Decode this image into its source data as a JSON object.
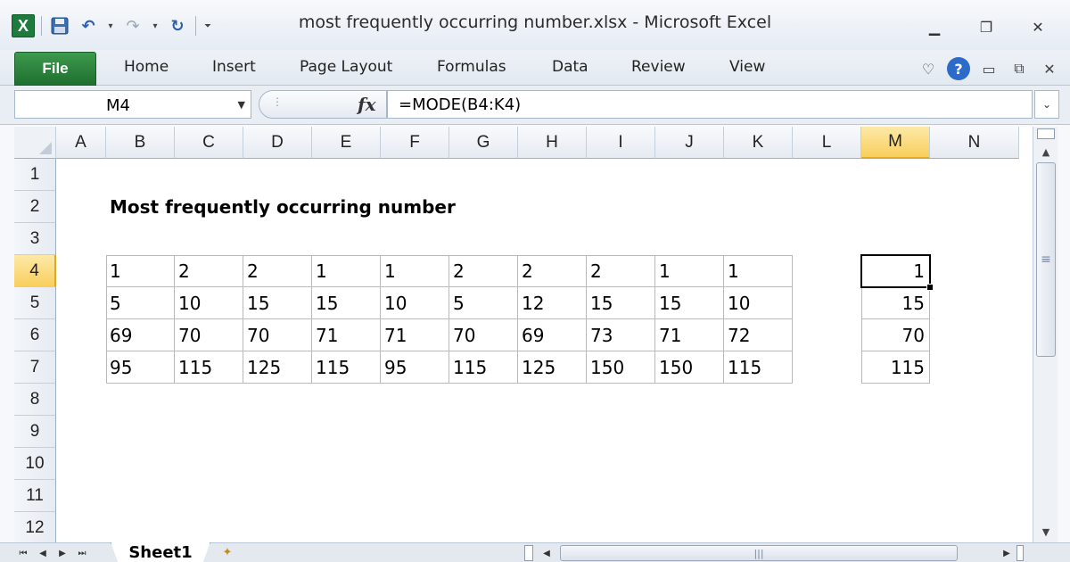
{
  "window": {
    "title": "most frequently occurring number.xlsx  -  Microsoft Excel",
    "app_icon": "X",
    "controls": {
      "minimize": "▭",
      "restore": "⧉",
      "close": "✕"
    }
  },
  "qat": {
    "save_icon": "💾",
    "undo_icon": "↶",
    "redo_icon": "↷",
    "refresh_icon": "↻",
    "dropdown": "▾",
    "customize": "⏷"
  },
  "ribbon": {
    "file_label": "File",
    "tabs": [
      {
        "label": "Home"
      },
      {
        "label": "Insert"
      },
      {
        "label": "Page Layout"
      },
      {
        "label": "Formulas"
      },
      {
        "label": "Data"
      },
      {
        "label": "Review"
      },
      {
        "label": "View"
      }
    ],
    "right": {
      "collapse": "♡",
      "help": "?",
      "min": "▭",
      "restore": "⧉",
      "close": "✕"
    }
  },
  "formula_bar": {
    "name_box": "M4",
    "fx_label": "fx",
    "formula": "=MODE(B4:K4)"
  },
  "grid": {
    "columns": [
      "A",
      "B",
      "C",
      "D",
      "E",
      "F",
      "G",
      "H",
      "I",
      "J",
      "K",
      "L",
      "M",
      "N"
    ],
    "rows": [
      "1",
      "2",
      "3",
      "4",
      "5",
      "6",
      "7",
      "8",
      "9",
      "10",
      "11",
      "12"
    ],
    "active_cell": "M4",
    "title": "Most frequently occurring number",
    "data": [
      [
        1,
        2,
        2,
        1,
        1,
        2,
        2,
        2,
        1,
        1
      ],
      [
        5,
        10,
        15,
        15,
        10,
        5,
        12,
        15,
        15,
        10
      ],
      [
        69,
        70,
        70,
        71,
        71,
        70,
        69,
        73,
        71,
        72
      ],
      [
        95,
        115,
        125,
        115,
        95,
        115,
        125,
        150,
        150,
        115
      ]
    ],
    "results": [
      1,
      15,
      70,
      115
    ]
  },
  "sheets": {
    "active": "Sheet1",
    "new_sheet_icon": "✦"
  },
  "colors": {
    "file_tab": "#2a7f3a",
    "active_header": "#f8cf5c",
    "excel_green": "#1e7a3d"
  }
}
